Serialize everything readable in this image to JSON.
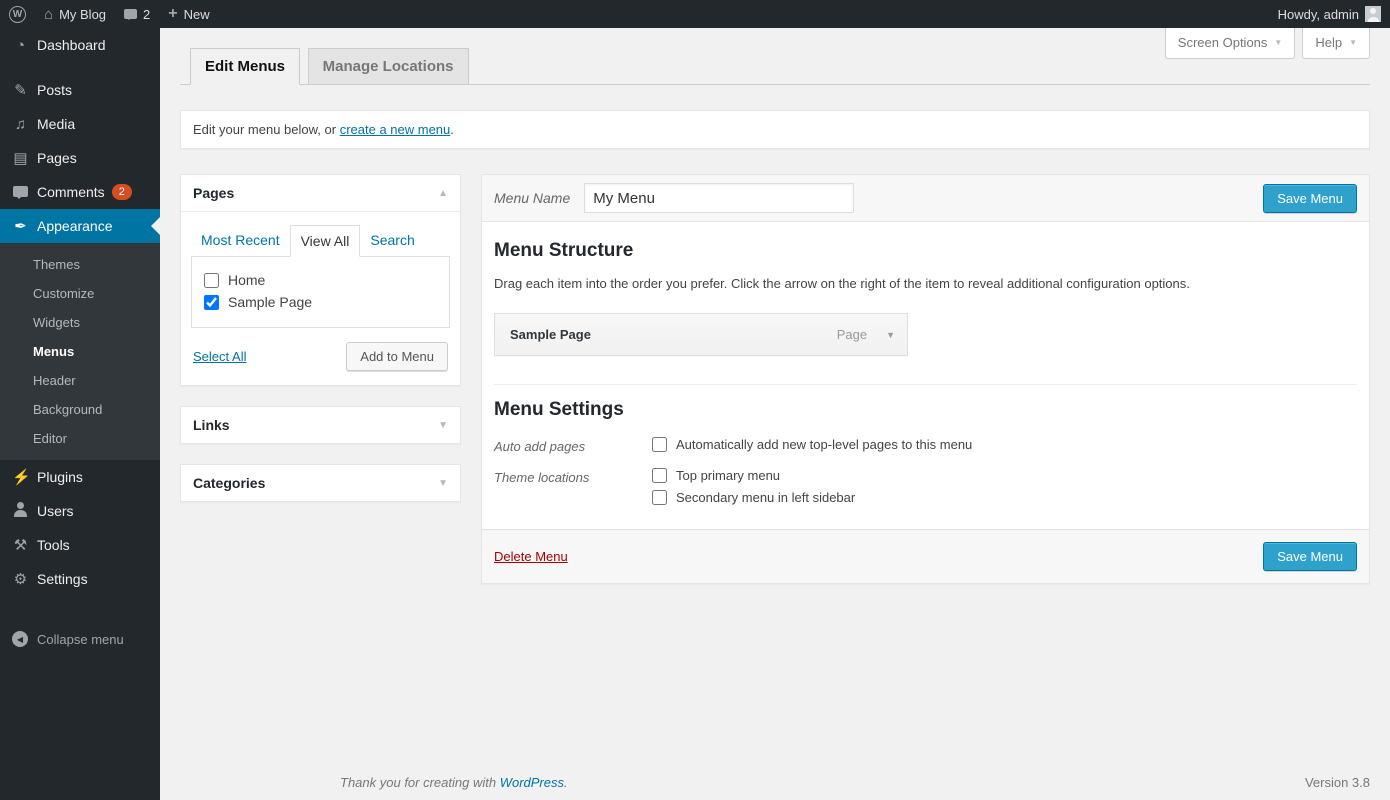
{
  "colors": {
    "menu_dark": "#23282d",
    "highlight_blue": "#0074a2",
    "button_blue": "#2ea2cc",
    "badge_red": "#d54e21",
    "page_background": "#f1f1f1"
  },
  "admin_bar": {
    "wordpress_logo_icon": "wordpress-logo",
    "home_icon": "home",
    "site_name": "My Blog",
    "comments_icon": "comment-bubble",
    "comment_count": "2",
    "new_icon": "plus",
    "new_label": "New",
    "howdy_text": "Howdy, admin",
    "avatar_icon": "user-avatar"
  },
  "sidebar": {
    "items": [
      {
        "label": "Dashboard",
        "icon": "dashboard-gauge-icon"
      },
      {
        "label": "Posts",
        "icon": "pushpin-icon"
      },
      {
        "label": "Media",
        "icon": "media-music-note-icon"
      },
      {
        "label": "Pages",
        "icon": "stacked-pages-icon"
      },
      {
        "label": "Comments",
        "icon": "comment-bubble-icon",
        "badge": "2"
      },
      {
        "label": "Appearance",
        "icon": "paintbrush-icon",
        "active": true
      },
      {
        "label": "Plugins",
        "icon": "plug-icon"
      },
      {
        "label": "Users",
        "icon": "person-icon"
      },
      {
        "label": "Tools",
        "icon": "wrench-icon"
      },
      {
        "label": "Settings",
        "icon": "sliders-icon"
      }
    ],
    "appearance_submenu": [
      {
        "label": "Themes",
        "active": false
      },
      {
        "label": "Customize",
        "active": false
      },
      {
        "label": "Widgets",
        "active": false
      },
      {
        "label": "Menus",
        "active": true
      },
      {
        "label": "Header",
        "active": false
      },
      {
        "label": "Background",
        "active": false
      },
      {
        "label": "Editor",
        "active": false
      }
    ],
    "collapse_label": "Collapse menu",
    "collapse_icon": "circle-left-arrow"
  },
  "page_header": {
    "tabs": [
      {
        "label": "Edit Menus",
        "active": true
      },
      {
        "label": "Manage Locations",
        "active": false
      }
    ],
    "screen_options_label": "Screen Options",
    "help_label": "Help"
  },
  "notice": {
    "text_before": "Edit your menu below, or ",
    "link_text": "create a new menu",
    "text_after": "."
  },
  "pages_panel": {
    "title": "Pages",
    "toggle_icon": "collapse-up-arrow",
    "tabs": [
      {
        "label": "Most Recent",
        "active": false
      },
      {
        "label": "View All",
        "active": true
      },
      {
        "label": "Search",
        "active": false
      }
    ],
    "items": [
      {
        "label": "Home",
        "checked": false
      },
      {
        "label": "Sample Page",
        "checked": true
      }
    ],
    "select_all_label": "Select All",
    "add_button_label": "Add to Menu"
  },
  "links_panel": {
    "title": "Links",
    "toggle_icon": "expand-down-arrow"
  },
  "categories_panel": {
    "title": "Categories",
    "toggle_icon": "expand-down-arrow"
  },
  "menu_editor": {
    "name_label": "Menu Name",
    "name_value": "My Menu",
    "save_button_label": "Save Menu",
    "structure_title": "Menu Structure",
    "structure_help": "Drag each item into the order you prefer. Click the arrow on the right of the item to reveal additional configuration options.",
    "items": [
      {
        "label": "Sample Page",
        "type": "Page"
      }
    ],
    "settings_title": "Menu Settings",
    "auto_add_label": "Auto add pages",
    "auto_add_option": {
      "label": "Automatically add new top-level pages to this menu",
      "checked": false
    },
    "theme_locations_label": "Theme locations",
    "locations": [
      {
        "label": "Top primary menu",
        "checked": false
      },
      {
        "label": "Secondary menu in left sidebar",
        "checked": false
      }
    ],
    "delete_label": "Delete Menu"
  },
  "page_footer": {
    "thanks_before": "Thank you for creating with ",
    "link_text": "WordPress",
    "thanks_after": ".",
    "version": "Version 3.8"
  }
}
